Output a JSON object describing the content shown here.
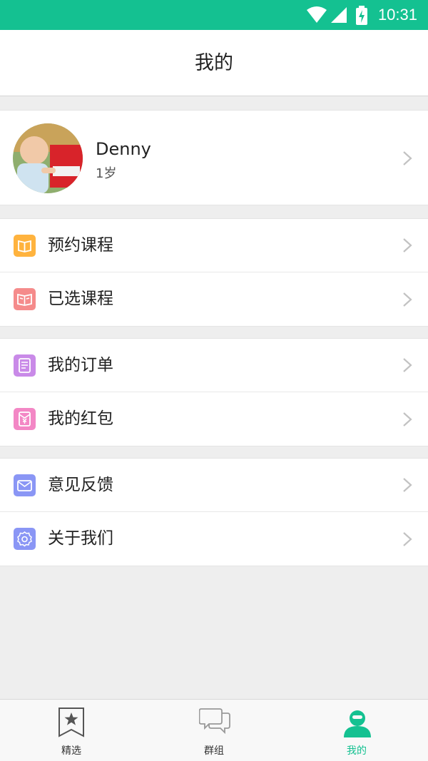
{
  "status_bar": {
    "time": "10:31"
  },
  "header": {
    "title": "我的"
  },
  "profile": {
    "name": "Denny",
    "age": "1岁"
  },
  "menu_groups": [
    {
      "items": [
        {
          "label": "预约课程",
          "icon": "book-icon",
          "color": "#ffb33e"
        },
        {
          "label": "已选课程",
          "icon": "open-book-icon",
          "color": "#f58b8b"
        }
      ]
    },
    {
      "items": [
        {
          "label": "我的订单",
          "icon": "order-list-icon",
          "color": "#c98ae8"
        },
        {
          "label": "我的红包",
          "icon": "red-envelope-icon",
          "color": "#f387c5"
        }
      ]
    },
    {
      "items": [
        {
          "label": "意见反馈",
          "icon": "mail-icon",
          "color": "#8a96f5"
        },
        {
          "label": "关于我们",
          "icon": "gear-icon",
          "color": "#8a96f5"
        }
      ]
    }
  ],
  "tabbar": {
    "tabs": [
      {
        "label": "精选",
        "icon": "bookmark-star-icon"
      },
      {
        "label": "群组",
        "icon": "chat-bubbles-icon"
      },
      {
        "label": "我的",
        "icon": "user-icon",
        "active": true
      }
    ]
  },
  "colors": {
    "accent": "#14c191"
  }
}
